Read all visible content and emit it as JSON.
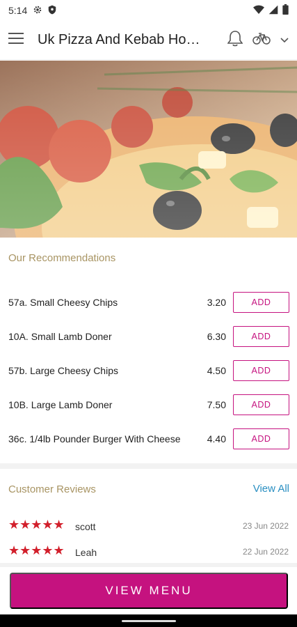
{
  "status": {
    "time": "5:14"
  },
  "appbar": {
    "title": "Uk Pizza And Kebab House"
  },
  "recommendations": {
    "title": "Our Recommendations",
    "items": [
      {
        "name": "57a. Small Cheesy Chips",
        "price": "3.20",
        "add_label": "ADD"
      },
      {
        "name": "10A. Small Lamb Doner",
        "price": "6.30",
        "add_label": "ADD"
      },
      {
        "name": "57b. Large Cheesy Chips",
        "price": "4.50",
        "add_label": "ADD"
      },
      {
        "name": "10B. Large Lamb Doner",
        "price": "7.50",
        "add_label": "ADD"
      },
      {
        "name": "36c. 1/4lb Pounder Burger With Cheese",
        "price": "4.40",
        "add_label": "ADD"
      }
    ]
  },
  "reviews": {
    "title": "Customer Reviews",
    "view_all": "View All",
    "items": [
      {
        "reviewer": "scott",
        "date": "23 Jun 2022",
        "stars": "★★★★★"
      },
      {
        "reviewer": "Leah",
        "date": "22 Jun 2022",
        "stars": "★★★★★"
      }
    ]
  },
  "footer": {
    "view_menu_label": "VIEW MENU"
  },
  "colors": {
    "accent": "#c5127f",
    "section_title": "#a89463",
    "stars": "#d21f2b",
    "link": "#2a8fc2"
  }
}
